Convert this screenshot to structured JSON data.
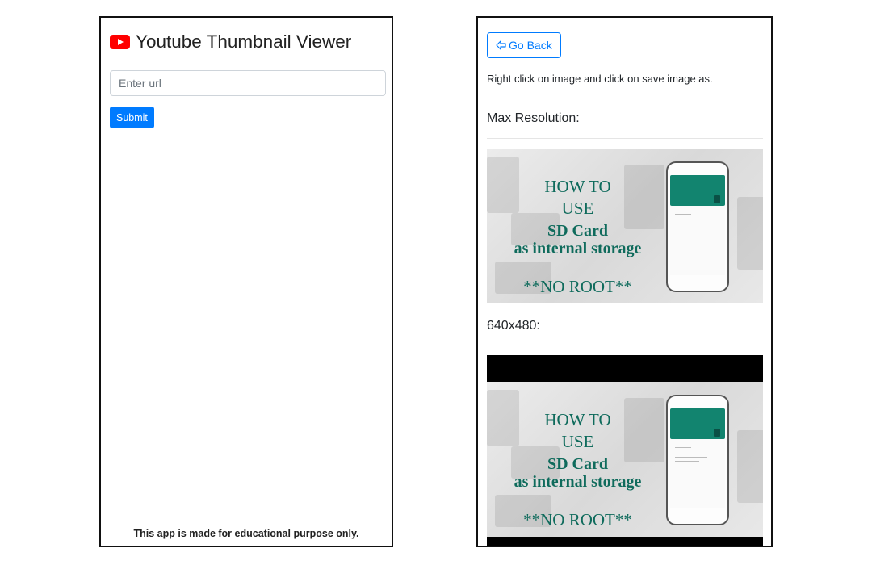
{
  "left_panel": {
    "title": "Youtube Thumbnail Viewer",
    "icon": "youtube-logo-icon",
    "brand_color": "#ff0000",
    "url_input": {
      "placeholder": "Enter url",
      "value": ""
    },
    "submit_label": "Submit",
    "footer_note": "This app is made for educational purpose only."
  },
  "right_panel": {
    "back_button_label": "Go Back",
    "back_icon": "arrow-left-icon",
    "instruction": "Right click on image and click on save image as.",
    "sections": [
      {
        "heading": "Max Resolution:"
      },
      {
        "heading": "640x480:"
      }
    ],
    "thumbnail_text": {
      "line1": "HOW TO",
      "line2": "USE",
      "line3": "SD Card",
      "line4": "as internal storage",
      "line5": "**NO ROOT**"
    }
  },
  "colors": {
    "primary": "#007bff",
    "thumbnail_text": "#0f6b5c",
    "phone_header": "#12846f"
  }
}
